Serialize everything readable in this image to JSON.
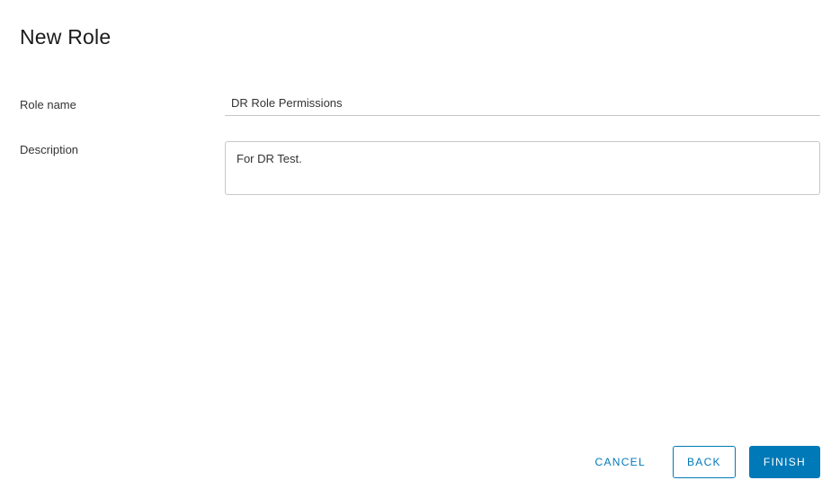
{
  "header": {
    "title": "New Role"
  },
  "form": {
    "roleName": {
      "label": "Role name",
      "value": "DR Role Permissions"
    },
    "description": {
      "label": "Description",
      "value": "For DR Test."
    }
  },
  "buttons": {
    "cancel": "CANCEL",
    "back": "BACK",
    "finish": "FINISH"
  }
}
